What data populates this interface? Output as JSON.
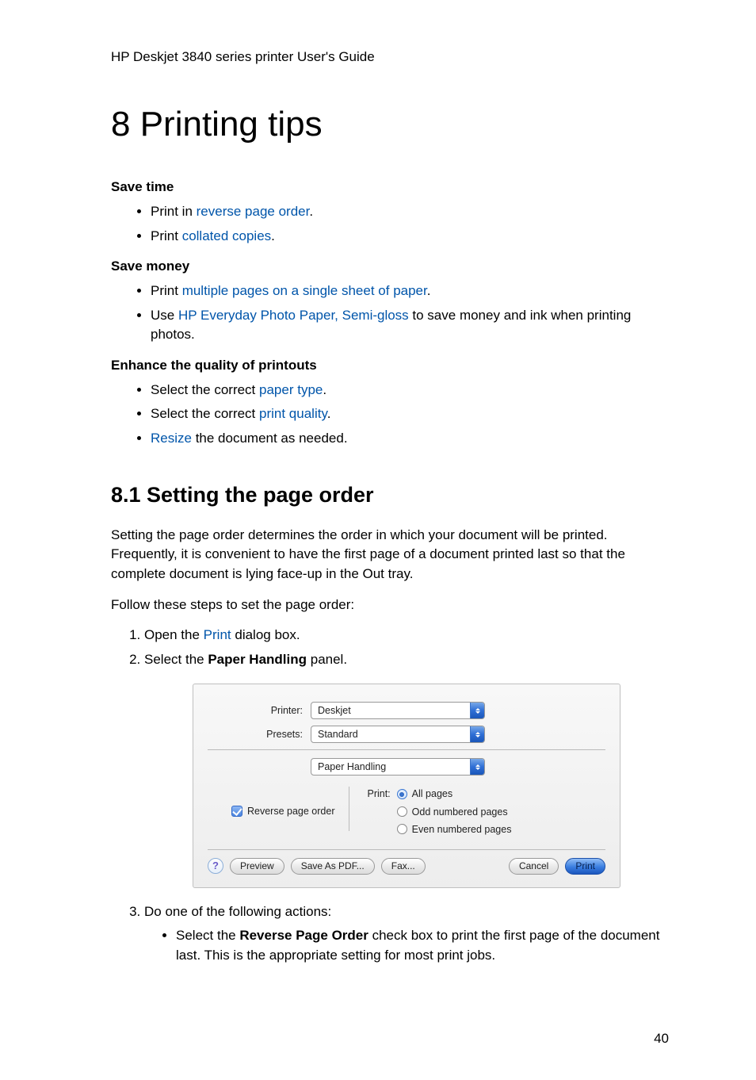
{
  "header": "HP Deskjet 3840 series printer User's Guide",
  "chapter_title": "8  Printing tips",
  "save_time": {
    "heading": "Save time",
    "item1_pre": "Print in ",
    "item1_link": "reverse page order",
    "item1_post": ".",
    "item2_pre": "Print ",
    "item2_link": "collated copies",
    "item2_post": "."
  },
  "save_money": {
    "heading": "Save money",
    "item1_pre": "Print ",
    "item1_link": "multiple pages on a single sheet of paper",
    "item1_post": ".",
    "item2_pre": "Use ",
    "item2_link": "HP Everyday Photo Paper, Semi-gloss",
    "item2_post": " to save money and ink when printing photos."
  },
  "enhance": {
    "heading": "Enhance the quality of printouts",
    "item1_pre": "Select the correct ",
    "item1_link": "paper type",
    "item1_post": ".",
    "item2_pre": "Select the correct ",
    "item2_link": "print quality",
    "item2_post": ".",
    "item3_link": "Resize",
    "item3_post": " the document as needed."
  },
  "section81": {
    "heading": "8.1  Setting the page order",
    "para1": "Setting the page order determines the order in which your document will be printed. Frequently, it is convenient to have the first page of a document printed last so that the complete document is lying face-up in the Out tray.",
    "para2": "Follow these steps to set the page order:",
    "step1_pre": "Open the ",
    "step1_link": "Print",
    "step1_post": " dialog box.",
    "step2_pre": "Select the ",
    "step2_bold": "Paper Handling",
    "step2_post": " panel.",
    "step3": "Do one of the following actions:",
    "sub1_pre": "Select the ",
    "sub1_bold": "Reverse Page Order",
    "sub1_post": " check box to print the first page of the document last. This is the appropriate setting for most print jobs."
  },
  "dialog": {
    "printer_label": "Printer:",
    "printer_value": "Deskjet",
    "presets_label": "Presets:",
    "presets_value": "Standard",
    "panel_value": "Paper Handling",
    "reverse_cb": "Reverse page order",
    "print_label": "Print:",
    "radio_all": "All pages",
    "radio_odd": "Odd numbered pages",
    "radio_even": "Even numbered pages",
    "help_glyph": "?",
    "btn_preview": "Preview",
    "btn_saveas": "Save As PDF...",
    "btn_fax": "Fax...",
    "btn_cancel": "Cancel",
    "btn_print": "Print"
  },
  "page_number": "40"
}
